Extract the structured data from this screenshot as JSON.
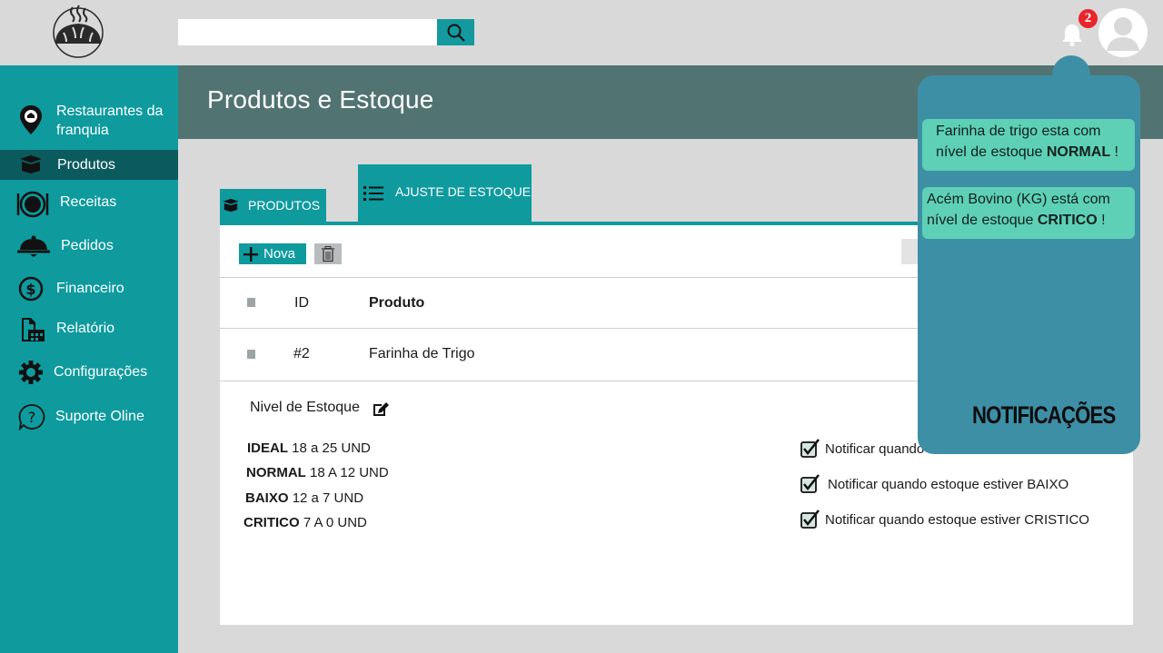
{
  "app": {
    "accent": "#0f9a9e",
    "sidebar_active": "#0b5a5e",
    "header_band": "#517371",
    "notif_bg": "#3d8fa6",
    "notif_card": "#5ed0b6",
    "badge_color": "#e8252b"
  },
  "topbar": {
    "search_placeholder": "",
    "notification_count": "2"
  },
  "sidebar": {
    "items": [
      {
        "label_line1": "Restaurantes da",
        "label_line2": "franquia",
        "icon": "location-pin-icon"
      },
      {
        "label": "Produtos",
        "icon": "box-icon",
        "active": true
      },
      {
        "label": "Receitas",
        "icon": "plate-icon"
      },
      {
        "label": "Pedidos",
        "icon": "cloche-icon"
      },
      {
        "label": "Financeiro",
        "icon": "dollar-circle-icon"
      },
      {
        "label": "Relatório",
        "icon": "report-icon"
      },
      {
        "label": "Configurações",
        "icon": "gear-icon"
      },
      {
        "label": "Suporte Oline",
        "icon": "question-circle-icon"
      }
    ]
  },
  "main": {
    "title": "Produtos e Estoque",
    "tabs": [
      {
        "label": "PRODUTOS",
        "icon": "box-icon"
      },
      {
        "label": "AJUSTE DE ESTOQUE",
        "icon": "list-icon",
        "active": true
      }
    ],
    "toolbar": {
      "new_label": "Nova"
    },
    "table": {
      "headers": {
        "id": "ID",
        "product": "Produto"
      },
      "rows": [
        {
          "id": "#2",
          "product": "Farinha de Trigo"
        }
      ]
    },
    "stock": {
      "label": "Nivel de Estoque",
      "levels": [
        {
          "name": "IDEAL",
          "range": "18 a 25 UND"
        },
        {
          "name": "NORMAL",
          "range": "18 A 12 UND"
        },
        {
          "name": "BAIXO",
          "range": "12 a 7 UND"
        },
        {
          "name": "CRITICO",
          "range": "7 A 0 UND"
        }
      ],
      "options": [
        {
          "label": "Notificar quando",
          "checked": true
        },
        {
          "label": "Notificar quando estoque estiver BAIXO",
          "checked": true
        },
        {
          "label": "Notificar quando estoque estiver CRISTICO",
          "checked": true
        }
      ]
    }
  },
  "notifications": {
    "title": "NOTIFICAÇÕES",
    "items": [
      {
        "line1": "Farinha de trigo  esta com",
        "line2_prefix": "nível de estoque ",
        "line2_bold": "NORMAL",
        "line2_suffix": " !"
      },
      {
        "line1": "Acém Bovino (KG) está com",
        "line2_prefix": "nível de estoque ",
        "line2_bold": "CRITICO",
        "line2_suffix": " !"
      }
    ]
  }
}
